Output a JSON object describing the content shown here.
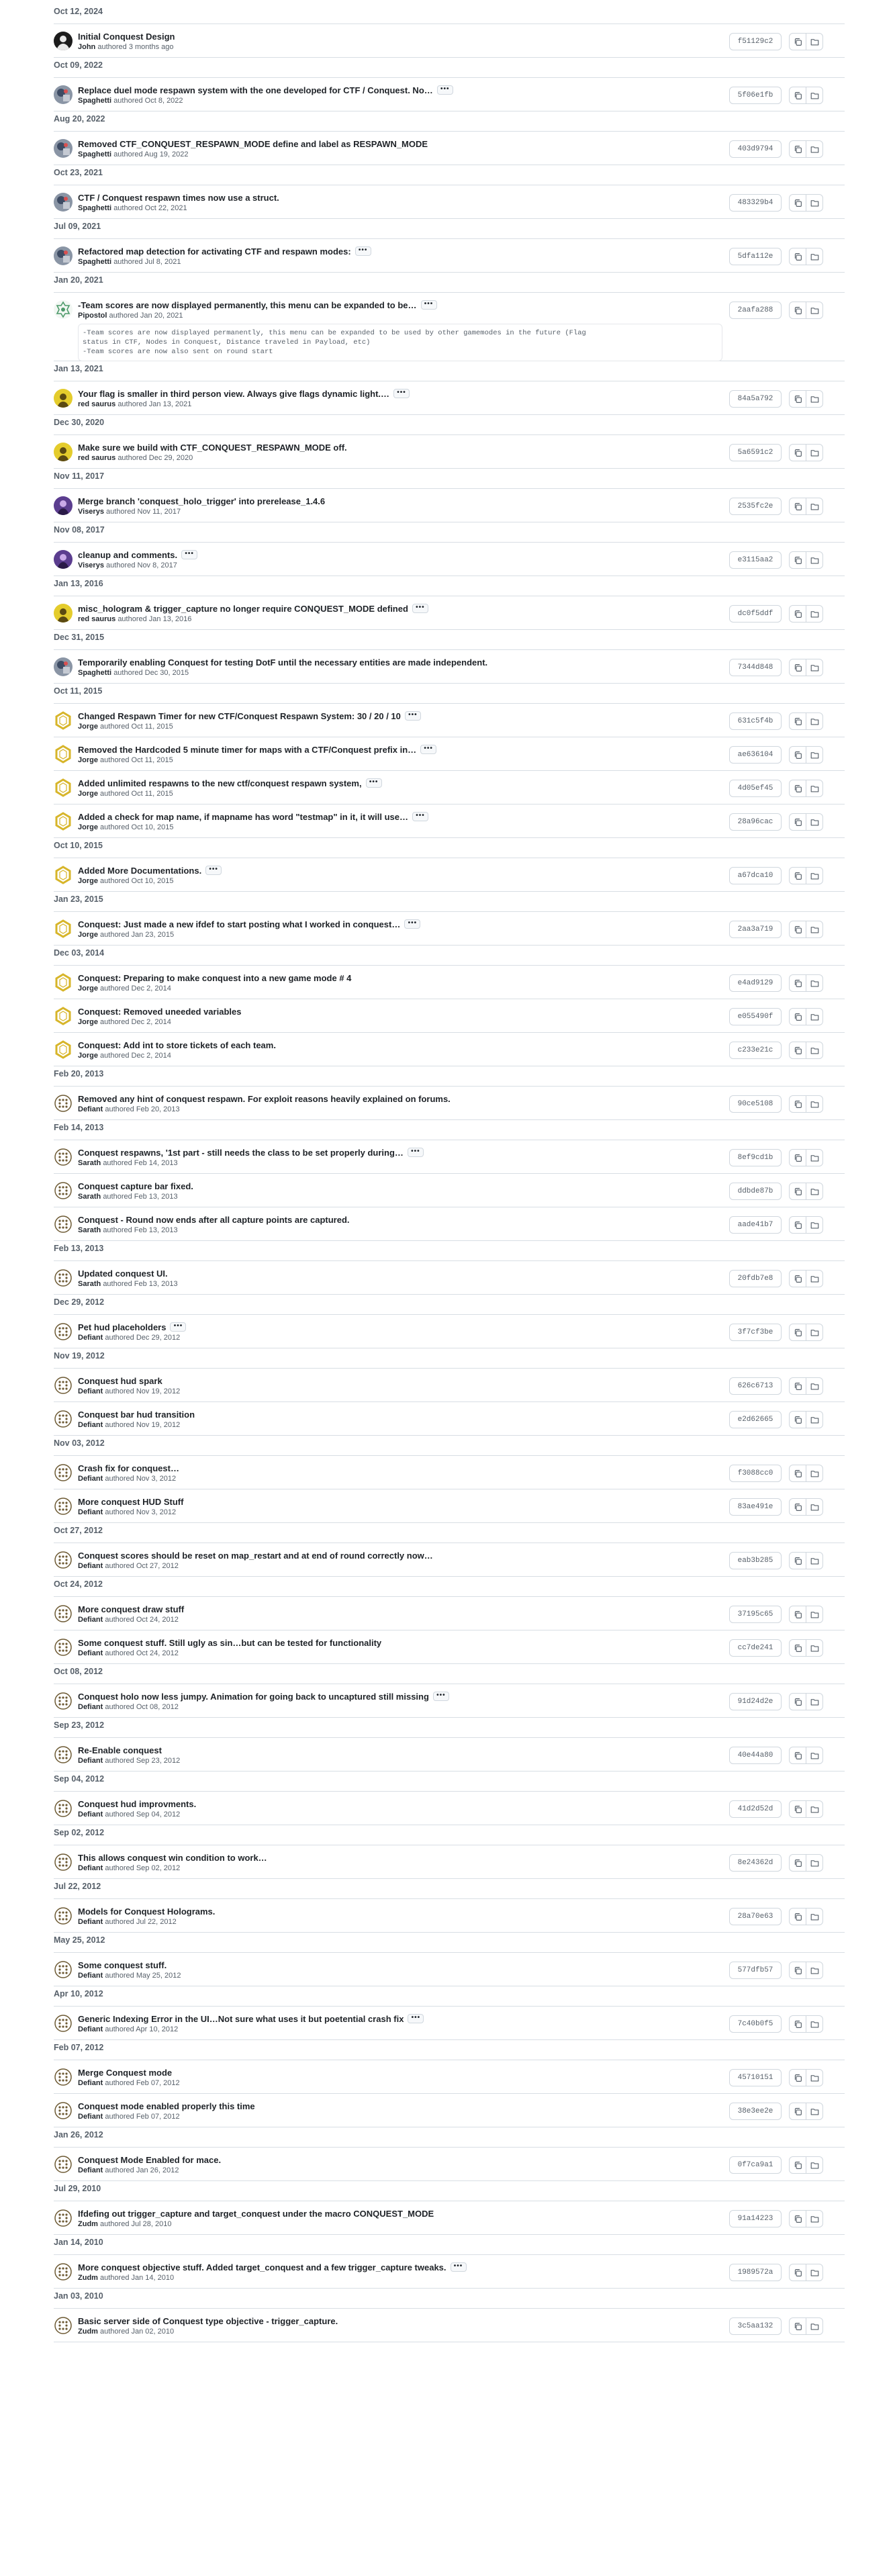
{
  "colors": {
    "border": "#d8dee4",
    "text_muted": "#57606a",
    "text_strong": "#1f2328",
    "button_border": "#d0d7de"
  },
  "icons": {
    "copy": "copy-icon",
    "browse": "folder-icon",
    "more": "ellipsis-icon"
  },
  "groups": [
    {
      "date": "Oct 12, 2024",
      "commits": [
        {
          "title": "Initial Conquest Design",
          "author": "John",
          "when": "authored 3 months ago",
          "sha": "f51129c2",
          "avatar": "dark",
          "more": false
        }
      ]
    },
    {
      "date": "Oct 09, 2022",
      "commits": [
        {
          "title": "Replace duel mode respawn system with the one developed for CTF / Conquest. No…",
          "author": "Spaghetti",
          "when": "authored Oct 8, 2022",
          "sha": "5f06e1fb",
          "avatar": "gray",
          "more": true
        }
      ]
    },
    {
      "date": "Aug 20, 2022",
      "commits": [
        {
          "title": "Removed CTF_CONQUEST_RESPAWN_MODE define and label as RESPAWN_MODE",
          "author": "Spaghetti",
          "when": "authored Aug 19, 2022",
          "sha": "403d9794",
          "avatar": "gray",
          "more": false
        }
      ]
    },
    {
      "date": "Oct 23, 2021",
      "commits": [
        {
          "title": "CTF / Conquest respawn times now use a struct.",
          "author": "Spaghetti",
          "when": "authored Oct 22, 2021",
          "sha": "483329b4",
          "avatar": "gray",
          "more": false
        }
      ]
    },
    {
      "date": "Jul 09, 2021",
      "commits": [
        {
          "title": "Refactored map detection for activating CTF and respawn modes:",
          "author": "Spaghetti",
          "when": "authored Jul 8, 2021",
          "sha": "5dfa112e",
          "avatar": "gray",
          "more": true
        }
      ]
    },
    {
      "date": "Jan 20, 2021",
      "commits": [
        {
          "title": "-Team scores are now displayed permanently, this menu can be expanded to be…",
          "author": "Pipostol",
          "when": "authored Jan 20, 2021",
          "sha": "2aafa288",
          "avatar": "green",
          "more": true,
          "body": "-Team scores are now displayed permanently, this menu can be expanded to be used by other gamemodes in the future (Flag\nstatus in CTF, Nodes in Conquest, Distance traveled in Payload, etc)\n-Team scores are now also sent on round start"
        }
      ]
    },
    {
      "date": "Jan 13, 2021",
      "commits": [
        {
          "title": "Your flag is smaller in third person view. Always give flags dynamic light.…",
          "author": "red saurus",
          "when": "authored Jan 13, 2021",
          "sha": "84a5a792",
          "avatar": "yellow",
          "more": true
        }
      ]
    },
    {
      "date": "Dec 30, 2020",
      "commits": [
        {
          "title": "Make sure we build with CTF_CONQUEST_RESPAWN_MODE off.",
          "author": "red saurus",
          "when": "authored Dec 29, 2020",
          "sha": "5a6591c2",
          "avatar": "yellow",
          "more": false
        }
      ]
    },
    {
      "date": "Nov 11, 2017",
      "commits": [
        {
          "title": "Merge branch 'conquest_holo_trigger' into prerelease_1.4.6",
          "author": "Viserys",
          "when": "authored Nov 11, 2017",
          "sha": "2535fc2e",
          "avatar": "purple",
          "more": false
        }
      ]
    },
    {
      "date": "Nov 08, 2017",
      "commits": [
        {
          "title": "cleanup and comments.",
          "author": "Viserys",
          "when": "authored Nov 8, 2017",
          "sha": "e3115aa2",
          "avatar": "purple",
          "more": true
        }
      ]
    },
    {
      "date": "Jan 13, 2016",
      "commits": [
        {
          "title": "misc_hologram & trigger_capture no longer require CONQUEST_MODE defined",
          "author": "red saurus",
          "when": "authored Jan 13, 2016",
          "sha": "dc0f5ddf",
          "avatar": "yellow",
          "more": true
        }
      ]
    },
    {
      "date": "Dec 31, 2015",
      "commits": [
        {
          "title": "Temporarily enabling Conquest for testing DotF until the necessary entities are made independent.",
          "author": "Spaghetti",
          "when": "authored Dec 30, 2015",
          "sha": "7344d848",
          "avatar": "gray",
          "more": false
        }
      ]
    },
    {
      "date": "Oct 11, 2015",
      "commits": [
        {
          "title": "Changed Respawn Timer for new CTF/Conquest Respawn System: 30 / 20 / 10",
          "author": "Jorge",
          "when": "authored Oct 11, 2015",
          "sha": "631c5f4b",
          "avatar": "ring",
          "more": true
        },
        {
          "title": "Removed the Hardcoded 5 minute timer for maps with a CTF/Conquest prefix in…",
          "author": "Jorge",
          "when": "authored Oct 11, 2015",
          "sha": "ae636104",
          "avatar": "ring",
          "more": true
        },
        {
          "title": "Added unlimited respawns to the new ctf/conquest respawn system,",
          "author": "Jorge",
          "when": "authored Oct 11, 2015",
          "sha": "4d05ef45",
          "avatar": "ring",
          "more": true
        },
        {
          "title": "Added a check for map name, if mapname has word \"testmap\" in it, it will use…",
          "author": "Jorge",
          "when": "authored Oct 10, 2015",
          "sha": "28a96cac",
          "avatar": "ring",
          "more": true
        }
      ]
    },
    {
      "date": "Oct 10, 2015",
      "commits": [
        {
          "title": "Added More Documentations.",
          "author": "Jorge",
          "when": "authored Oct 10, 2015",
          "sha": "a67dca10",
          "avatar": "ring",
          "more": true
        }
      ]
    },
    {
      "date": "Jan 23, 2015",
      "commits": [
        {
          "title": "Conquest: Just made a new ifdef to start posting what I worked in conquest…",
          "author": "Jorge",
          "when": "authored Jan 23, 2015",
          "sha": "2aa3a719",
          "avatar": "ring",
          "more": true
        }
      ]
    },
    {
      "date": "Dec 03, 2014",
      "commits": [
        {
          "title": "Conquest: Preparing to make conquest into a new game mode # 4",
          "author": "Jorge",
          "when": "authored Dec 2, 2014",
          "sha": "e4ad9129",
          "avatar": "ring",
          "more": false
        },
        {
          "title": "Conquest: Removed uneeded variables",
          "author": "Jorge",
          "when": "authored Dec 2, 2014",
          "sha": "e055490f",
          "avatar": "ring",
          "more": false
        },
        {
          "title": "Conquest: Add int to store tickets of each team.",
          "author": "Jorge",
          "when": "authored Dec 2, 2014",
          "sha": "c233e21c",
          "avatar": "ring",
          "more": false
        }
      ]
    },
    {
      "date": "Feb 20, 2013",
      "commits": [
        {
          "title": "Removed any hint of conquest respawn. For exploit reasons heavily explained on forums.",
          "author": "Defiant",
          "when": "authored Feb 20, 2013",
          "sha": "90ce5108",
          "avatar": "dots",
          "more": false
        }
      ]
    },
    {
      "date": "Feb 14, 2013",
      "commits": [
        {
          "title": "Conquest respawns, '1st part - still needs the class to be set properly during…",
          "author": "Sarath",
          "when": "authored Feb 14, 2013",
          "sha": "8ef9cd1b",
          "avatar": "dots",
          "more": true
        },
        {
          "title": "Conquest capture bar fixed.",
          "author": "Sarath",
          "when": "authored Feb 13, 2013",
          "sha": "ddbde87b",
          "avatar": "dots",
          "more": false
        },
        {
          "title": "Conquest - Round now ends after all capture points are captured.",
          "author": "Sarath",
          "when": "authored Feb 13, 2013",
          "sha": "aade41b7",
          "avatar": "dots",
          "more": false
        }
      ]
    },
    {
      "date": "Feb 13, 2013",
      "commits": [
        {
          "title": "Updated conquest UI.",
          "author": "Sarath",
          "when": "authored Feb 13, 2013",
          "sha": "20fdb7e8",
          "avatar": "dots",
          "more": false
        }
      ]
    },
    {
      "date": "Dec 29, 2012",
      "commits": [
        {
          "title": "Pet hud placeholders",
          "author": "Defiant",
          "when": "authored Dec 29, 2012",
          "sha": "3f7cf3be",
          "avatar": "dots",
          "more": true
        }
      ]
    },
    {
      "date": "Nov 19, 2012",
      "commits": [
        {
          "title": "Conquest hud spark",
          "author": "Defiant",
          "when": "authored Nov 19, 2012",
          "sha": "626c6713",
          "avatar": "dots",
          "more": false
        },
        {
          "title": "Conquest bar hud transition",
          "author": "Defiant",
          "when": "authored Nov 19, 2012",
          "sha": "e2d62665",
          "avatar": "dots",
          "more": false
        }
      ]
    },
    {
      "date": "Nov 03, 2012",
      "commits": [
        {
          "title": "Crash fix for conquest…",
          "author": "Defiant",
          "when": "authored Nov 3, 2012",
          "sha": "f3088cc0",
          "avatar": "dots",
          "more": false
        },
        {
          "title": "More conquest HUD Stuff",
          "author": "Defiant",
          "when": "authored Nov 3, 2012",
          "sha": "83ae491e",
          "avatar": "dots",
          "more": false
        }
      ]
    },
    {
      "date": "Oct 27, 2012",
      "commits": [
        {
          "title": "Conquest scores should be reset on map_restart and at end of round correctly now…",
          "author": "Defiant",
          "when": "authored Oct 27, 2012",
          "sha": "eab3b285",
          "avatar": "dots",
          "more": false
        }
      ]
    },
    {
      "date": "Oct 24, 2012",
      "commits": [
        {
          "title": "More conquest draw stuff",
          "author": "Defiant",
          "when": "authored Oct 24, 2012",
          "sha": "37195c65",
          "avatar": "dots",
          "more": false
        },
        {
          "title": "Some conquest stuff. Still ugly as sin…but can be tested for functionality",
          "author": "Defiant",
          "when": "authored Oct 24, 2012",
          "sha": "cc7de241",
          "avatar": "dots",
          "more": false
        }
      ]
    },
    {
      "date": "Oct 08, 2012",
      "commits": [
        {
          "title": "Conquest holo now less jumpy. Animation for going back to uncaptured still missing",
          "author": "Defiant",
          "when": "authored Oct 08, 2012",
          "sha": "91d24d2e",
          "avatar": "dots",
          "more": true
        }
      ]
    },
    {
      "date": "Sep 23, 2012",
      "commits": [
        {
          "title": "Re-Enable conquest",
          "author": "Defiant",
          "when": "authored Sep 23, 2012",
          "sha": "40e44a80",
          "avatar": "dots",
          "more": false
        }
      ]
    },
    {
      "date": "Sep 04, 2012",
      "commits": [
        {
          "title": "Conquest hud improvments.",
          "author": "Defiant",
          "when": "authored Sep 04, 2012",
          "sha": "41d2d52d",
          "avatar": "dots",
          "more": false
        }
      ]
    },
    {
      "date": "Sep 02, 2012",
      "commits": [
        {
          "title": "This allows conquest win condition to work…",
          "author": "Defiant",
          "when": "authored Sep 02, 2012",
          "sha": "8e24362d",
          "avatar": "dots",
          "more": false
        }
      ]
    },
    {
      "date": "Jul 22, 2012",
      "commits": [
        {
          "title": "Models for Conquest Holograms.",
          "author": "Defiant",
          "when": "authored Jul 22, 2012",
          "sha": "28a70e63",
          "avatar": "dots",
          "more": false
        }
      ]
    },
    {
      "date": "May 25, 2012",
      "commits": [
        {
          "title": "Some conquest stuff.",
          "author": "Defiant",
          "when": "authored May 25, 2012",
          "sha": "577dfb57",
          "avatar": "dots",
          "more": false
        }
      ]
    },
    {
      "date": "Apr 10, 2012",
      "commits": [
        {
          "title": "Generic Indexing Error in the UI…Not sure what uses it but poetential crash fix",
          "author": "Defiant",
          "when": "authored Apr 10, 2012",
          "sha": "7c40b0f5",
          "avatar": "dots",
          "more": true
        }
      ]
    },
    {
      "date": "Feb 07, 2012",
      "commits": [
        {
          "title": "Merge Conquest mode",
          "author": "Defiant",
          "when": "authored Feb 07, 2012",
          "sha": "45710151",
          "avatar": "dots",
          "more": false
        },
        {
          "title": "Conquest mode enabled properly this time",
          "author": "Defiant",
          "when": "authored Feb 07, 2012",
          "sha": "38e3ee2e",
          "avatar": "dots",
          "more": false
        }
      ]
    },
    {
      "date": "Jan 26, 2012",
      "commits": [
        {
          "title": "Conquest Mode Enabled for mace.",
          "author": "Defiant",
          "when": "authored Jan 26, 2012",
          "sha": "0f7ca9a1",
          "avatar": "dots",
          "more": false
        }
      ]
    },
    {
      "date": "Jul 29, 2010",
      "commits": [
        {
          "title": "Ifdefing out trigger_capture and target_conquest under the macro CONQUEST_MODE",
          "author": "Zudm",
          "when": "authored Jul 28, 2010",
          "sha": "91a14223",
          "avatar": "dots",
          "more": false
        }
      ]
    },
    {
      "date": "Jan 14, 2010",
      "commits": [
        {
          "title": "More conquest objective stuff. Added target_conquest and a few trigger_capture tweaks.",
          "author": "Zudm",
          "when": "authored Jan 14, 2010",
          "sha": "1989572a",
          "avatar": "dots",
          "more": true
        }
      ]
    },
    {
      "date": "Jan 03, 2010",
      "commits": [
        {
          "title": "Basic server side of Conquest type objective - trigger_capture.",
          "author": "Zudm",
          "when": "authored Jan 02, 2010",
          "sha": "3c5aa132",
          "avatar": "dots",
          "more": false
        }
      ]
    }
  ]
}
